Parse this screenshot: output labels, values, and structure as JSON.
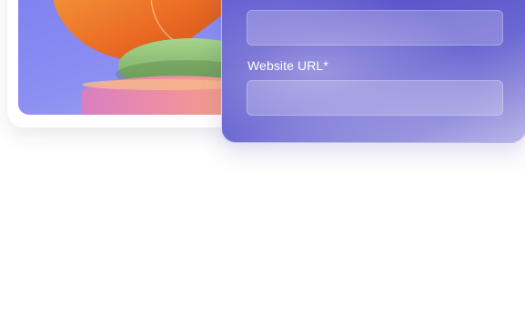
{
  "form": {
    "website_url_label": "Website URL*",
    "name_field_value": "",
    "website_url_value": ""
  },
  "illustration": {
    "icon": "abstract-3d-shapes-icon",
    "colors": {
      "background": "#8b8ef2",
      "orange": "#f07a2e",
      "green": "#8cc17a",
      "pink": "#e48ab4",
      "peach": "#f3a07b"
    }
  },
  "theme": {
    "form_card_color": "#5b55cc",
    "page_background": "#ffffff"
  }
}
